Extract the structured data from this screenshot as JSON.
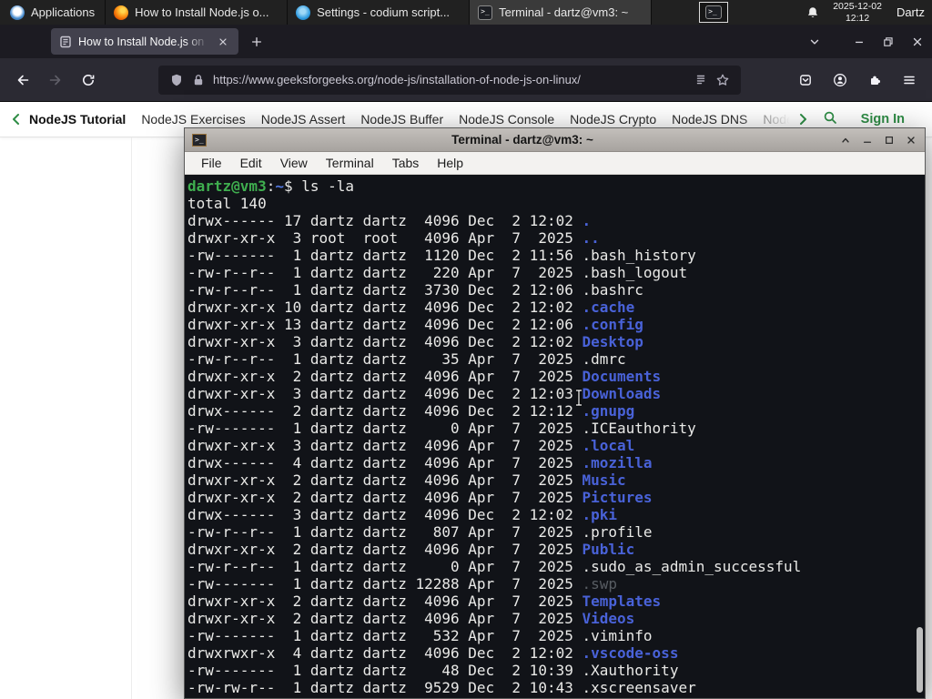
{
  "panel": {
    "applications_label": "Applications",
    "tasks": [
      {
        "label": "How to Install Node.js o...",
        "icon": "firefox-icon"
      },
      {
        "label": "Settings - codium script...",
        "icon": "codium-icon"
      },
      {
        "label": "Terminal - dartz@vm3: ~",
        "icon": "terminal-icon"
      }
    ],
    "clock": {
      "date": "2025-12-02",
      "time": "12:12"
    },
    "user_label": "Dartz"
  },
  "browser": {
    "tab": {
      "title": "How to Install Node.js on"
    },
    "urlbar": {
      "url": "https://www.geeksforgeeks.org/node-js/installation-of-node-js-on-linux/"
    }
  },
  "site_nav": {
    "items": [
      "NodeJS Tutorial",
      "NodeJS Exercises",
      "NodeJS Assert",
      "NodeJS Buffer",
      "NodeJS Console",
      "NodeJS Crypto",
      "NodeJS DNS",
      "Node"
    ],
    "sign_in_label": "Sign In",
    "accent_color": "#2f8d46"
  },
  "terminal": {
    "window_title": "Terminal - dartz@vm3: ~",
    "menu": [
      "File",
      "Edit",
      "View",
      "Terminal",
      "Tabs",
      "Help"
    ],
    "prompt": {
      "user_host": "dartz@vm3",
      "colon": ":",
      "cwd": "~",
      "symbol": "$ ",
      "command": "ls -la"
    },
    "total_line": "total 140",
    "listing": [
      {
        "meta": "drwx------ 17 dartz dartz  4096 Dec  2 12:02 ",
        "name": ".",
        "color": "dir"
      },
      {
        "meta": "drwxr-xr-x  3 root  root   4096 Apr  7  2025 ",
        "name": "..",
        "color": "dir"
      },
      {
        "meta": "-rw-------  1 dartz dartz  1120 Dec  2 11:56 ",
        "name": ".bash_history",
        "color": "plain"
      },
      {
        "meta": "-rw-r--r--  1 dartz dartz   220 Apr  7  2025 ",
        "name": ".bash_logout",
        "color": "plain"
      },
      {
        "meta": "-rw-r--r--  1 dartz dartz  3730 Dec  2 12:06 ",
        "name": ".bashrc",
        "color": "plain"
      },
      {
        "meta": "drwxr-xr-x 10 dartz dartz  4096 Dec  2 12:02 ",
        "name": ".cache",
        "color": "dir"
      },
      {
        "meta": "drwxr-xr-x 13 dartz dartz  4096 Dec  2 12:06 ",
        "name": ".config",
        "color": "dir"
      },
      {
        "meta": "drwxr-xr-x  3 dartz dartz  4096 Dec  2 12:02 ",
        "name": "Desktop",
        "color": "dir"
      },
      {
        "meta": "-rw-r--r--  1 dartz dartz    35 Apr  7  2025 ",
        "name": ".dmrc",
        "color": "plain"
      },
      {
        "meta": "drwxr-xr-x  2 dartz dartz  4096 Apr  7  2025 ",
        "name": "Documents",
        "color": "dir"
      },
      {
        "meta": "drwxr-xr-x  3 dartz dartz  4096 Dec  2 12:03 ",
        "name": "Downloads",
        "color": "dir"
      },
      {
        "meta": "drwx------  2 dartz dartz  4096 Dec  2 12:12 ",
        "name": ".gnupg",
        "color": "dir"
      },
      {
        "meta": "-rw-------  1 dartz dartz     0 Apr  7  2025 ",
        "name": ".ICEauthority",
        "color": "plain"
      },
      {
        "meta": "drwxr-xr-x  3 dartz dartz  4096 Apr  7  2025 ",
        "name": ".local",
        "color": "dir"
      },
      {
        "meta": "drwx------  4 dartz dartz  4096 Apr  7  2025 ",
        "name": ".mozilla",
        "color": "dir"
      },
      {
        "meta": "drwxr-xr-x  2 dartz dartz  4096 Apr  7  2025 ",
        "name": "Music",
        "color": "dir"
      },
      {
        "meta": "drwxr-xr-x  2 dartz dartz  4096 Apr  7  2025 ",
        "name": "Pictures",
        "color": "dir"
      },
      {
        "meta": "drwx------  3 dartz dartz  4096 Dec  2 12:02 ",
        "name": ".pki",
        "color": "dir"
      },
      {
        "meta": "-rw-r--r--  1 dartz dartz   807 Apr  7  2025 ",
        "name": ".profile",
        "color": "plain"
      },
      {
        "meta": "drwxr-xr-x  2 dartz dartz  4096 Apr  7  2025 ",
        "name": "Public",
        "color": "dir"
      },
      {
        "meta": "-rw-r--r--  1 dartz dartz     0 Apr  7  2025 ",
        "name": ".sudo_as_admin_successful",
        "color": "plain"
      },
      {
        "meta": "-rw-------  1 dartz dartz 12288 Apr  7  2025 ",
        "name": ".swp",
        "color": "dim"
      },
      {
        "meta": "drwxr-xr-x  2 dartz dartz  4096 Apr  7  2025 ",
        "name": "Templates",
        "color": "dir"
      },
      {
        "meta": "drwxr-xr-x  2 dartz dartz  4096 Apr  7  2025 ",
        "name": "Videos",
        "color": "dir"
      },
      {
        "meta": "-rw-------  1 dartz dartz   532 Apr  7  2025 ",
        "name": ".viminfo",
        "color": "plain"
      },
      {
        "meta": "drwxrwxr-x  4 dartz dartz  4096 Dec  2 12:02 ",
        "name": ".vscode-oss",
        "color": "dir"
      },
      {
        "meta": "-rw-------  1 dartz dartz    48 Dec  2 10:39 ",
        "name": ".Xauthority",
        "color": "plain"
      },
      {
        "meta": "-rw-rw-r--  1 dartz dartz  9529 Dec  2 10:43 ",
        "name": ".xscreensaver",
        "color": "plain"
      }
    ],
    "colors": {
      "background": "#111318",
      "foreground": "#e9e9e7",
      "prompt_green": "#3fae4f",
      "dir_blue": "#4962d8",
      "dim": "#585d63"
    }
  }
}
